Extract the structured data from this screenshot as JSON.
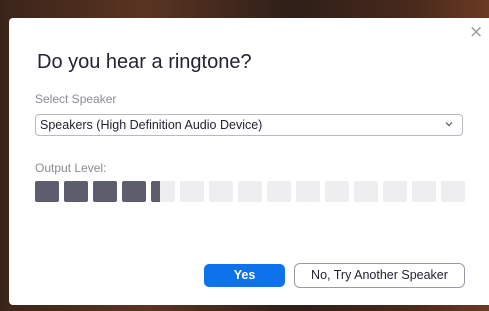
{
  "dialog": {
    "title": "Do you hear a ringtone?",
    "close_icon": "close-icon",
    "speaker": {
      "label": "Select Speaker",
      "selected": "Speakers (High Definition Audio Device)",
      "chevron_icon": "chevron-down-icon"
    },
    "output": {
      "label": "Output Level:",
      "segments_total": 15,
      "level_fraction": 0.29
    },
    "buttons": {
      "yes_label": "Yes",
      "no_label": "No, Try Another Speaker"
    }
  },
  "colors": {
    "primary": "#0e72ed",
    "meter_on": "#5c5d6d",
    "meter_off": "#eeeef1"
  }
}
